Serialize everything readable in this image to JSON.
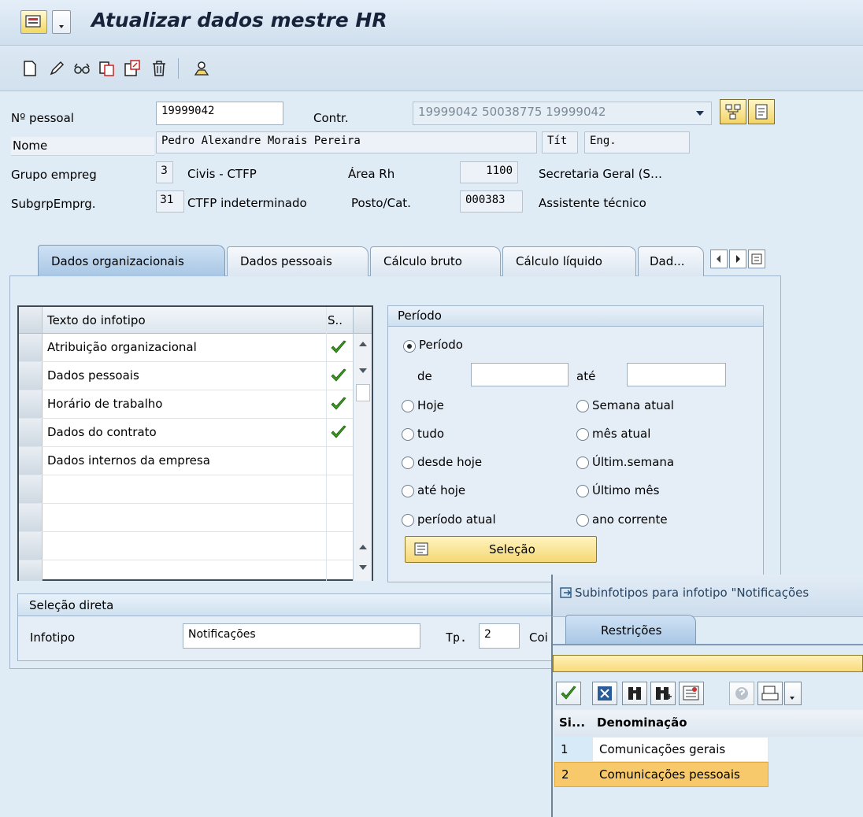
{
  "window": {
    "title": "Atualizar dados mestre HR"
  },
  "toolbar": {
    "icons": [
      "create-icon",
      "change-icon",
      "display-icon",
      "copy-icon",
      "delimit-icon",
      "delete-icon",
      "overview-icon"
    ]
  },
  "header": {
    "personnel_no_label": "Nº pessoal",
    "personnel_no_value": "19999042",
    "contract_label": "Contr.",
    "contract_value": "19999042 50038775 19999042",
    "name_label": "Nome",
    "name_value": "Pedro Alexandre Morais Pereira",
    "title_label": "Tít",
    "title_value": "Eng.",
    "emp_group_label": "Grupo empreg",
    "emp_group_code": "3",
    "emp_group_text": "Civis - CTFP",
    "hr_area_label": "Área Rh",
    "hr_area_code": "1100",
    "hr_area_text": "Secretaria Geral (S…",
    "emp_subgroup_label": "SubgrpEmprg.",
    "emp_subgroup_code": "31",
    "emp_subgroup_text": "CTFP indeterminado",
    "position_label": "Posto/Cat.",
    "position_code": "000383",
    "position_text": "Assistente técnico"
  },
  "tabs": [
    {
      "label": "Dados organizacionais",
      "active": true
    },
    {
      "label": "Dados pessoais"
    },
    {
      "label": "Cálculo bruto"
    },
    {
      "label": "Cálculo líquido"
    },
    {
      "label": "Dad..."
    }
  ],
  "infotype_table": {
    "col_text": "Texto do infotipo",
    "col_status": "S..",
    "rows": [
      {
        "text": "Atribuição organizacional",
        "checked": true
      },
      {
        "text": "Dados pessoais",
        "checked": true
      },
      {
        "text": "Horário de trabalho",
        "checked": true
      },
      {
        "text": "Dados do contrato",
        "checked": true
      },
      {
        "text": "Dados internos da empresa",
        "checked": false
      },
      {
        "text": ""
      },
      {
        "text": ""
      },
      {
        "text": ""
      },
      {
        "text": ""
      }
    ]
  },
  "period": {
    "title": "Período",
    "period_option": "Período",
    "from_label": "de",
    "to_label": "até",
    "from_value": "",
    "to_value": "",
    "options_left": [
      "Hoje",
      "tudo",
      "desde hoje",
      "até hoje",
      "período atual"
    ],
    "options_right": [
      "Semana atual",
      "mês atual",
      "Últim.semana",
      "Último mês",
      "ano corrente"
    ],
    "selection_button": "Seleção"
  },
  "direct_selection": {
    "title": "Seleção direta",
    "infotype_label": "Infotipo",
    "infotype_value": "Notificações",
    "type_label": "Tp.",
    "type_value": "2",
    "extra_label": "Coi"
  },
  "popup": {
    "title": "Subinfotipos para infotipo \"Notificações",
    "tab_label": "Restrições",
    "col_code": "Si...",
    "col_name": "Denominação",
    "rows": [
      {
        "code": "1",
        "name": "Comunicações gerais",
        "selected": false
      },
      {
        "code": "2",
        "name": "Comunicações pessoais",
        "selected": true
      }
    ]
  },
  "colors": {
    "background": "#dfebf5",
    "selection_yellow": "#f5d774",
    "check_green": "#3a9a1e",
    "title_text": "#17233a"
  }
}
